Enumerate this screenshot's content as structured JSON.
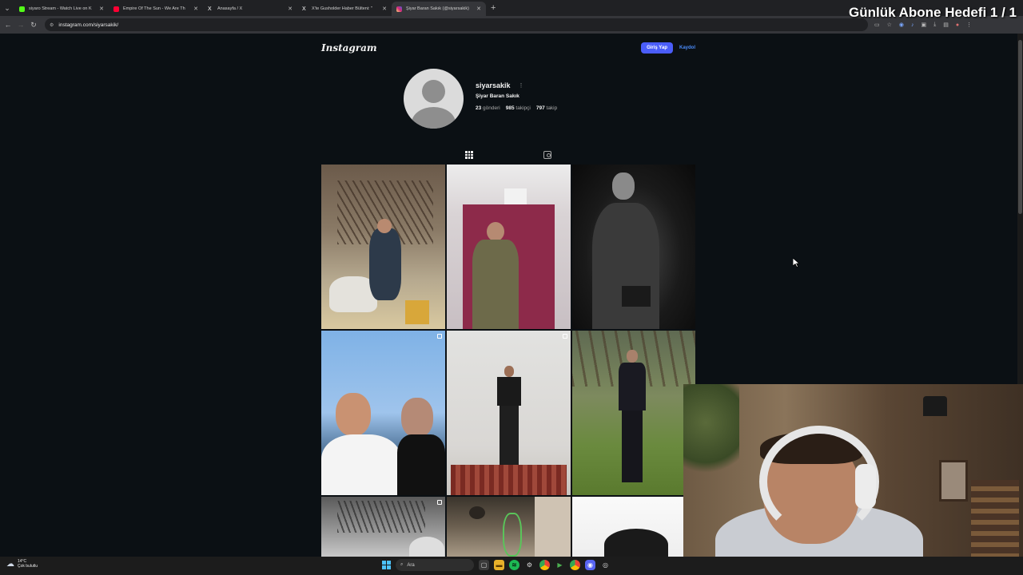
{
  "browser": {
    "tabs": [
      {
        "title": "siyaro Stream - Watch Live on K",
        "color": "#53fc18",
        "active": false
      },
      {
        "title": "Empire Of The Sun - We Are Th",
        "color": "#ff0033",
        "active": false
      },
      {
        "title": "Anasayfa / X",
        "color": "#ffffff",
        "active": false
      },
      {
        "title": "X'te Gusholder Haber Bülteni: \"",
        "color": "#ffffff",
        "active": false
      },
      {
        "title": "Şiyar Baran Sakık (@siyarsakik)",
        "color": "#e1306c",
        "active": true
      }
    ],
    "new_tab": "+",
    "url": "instagram.com/siyarsakik/"
  },
  "overlay": {
    "title": "Günlük Abone Hedefi 1 / 1"
  },
  "instagram": {
    "logo": "Instagram",
    "login_button": "Giriş Yap",
    "signup_link": "Kaydol",
    "profile": {
      "username": "siyarsakik",
      "full_name": "Şiyar Baran Sakık",
      "posts_count": "23",
      "posts_label": "gönderi",
      "followers_count": "985",
      "followers_label": "takipçi",
      "following_count": "797",
      "following_label": "takip"
    },
    "tabs": [
      {
        "icon": "grid-icon",
        "active": true
      },
      {
        "icon": "tagged-icon",
        "active": false
      }
    ],
    "posts": [
      {
        "scene": "man-on-scooter",
        "multi": false
      },
      {
        "scene": "mirror-selfie-camo",
        "multi": false
      },
      {
        "scene": "man-bw-portrait",
        "multi": false
      },
      {
        "scene": "two-men-selfie",
        "multi": true
      },
      {
        "scene": "man-on-rug-studio",
        "multi": true
      },
      {
        "scene": "man-in-suit-park",
        "multi": false
      },
      {
        "scene": "bw-street",
        "multi": true
      },
      {
        "scene": "room-interior",
        "multi": true
      },
      {
        "scene": "bw-portrait-hair",
        "multi": false
      }
    ]
  },
  "taskbar": {
    "weather_temp": "14°C",
    "weather_desc": "Çok bulutlu",
    "search_placeholder": "Ara"
  }
}
